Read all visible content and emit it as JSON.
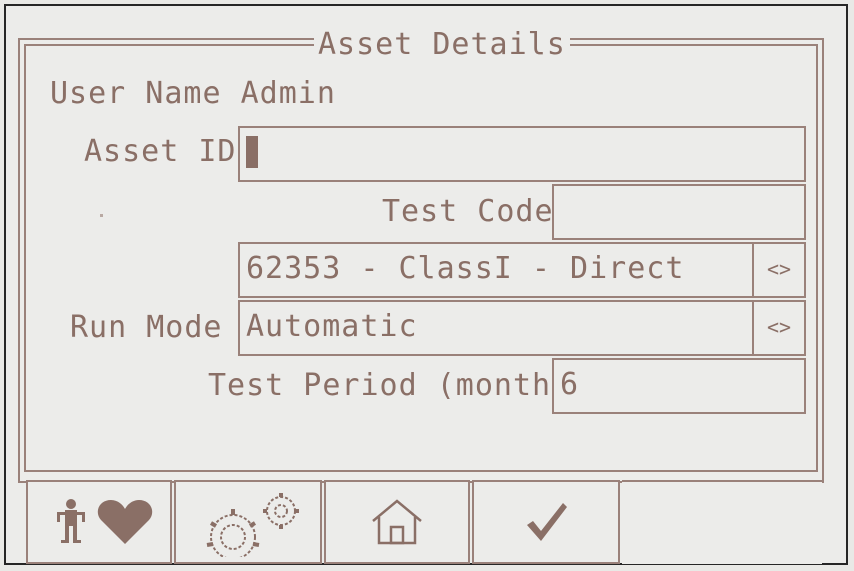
{
  "dialog": {
    "title": "Asset Details"
  },
  "form": {
    "user_name_label": "User Name",
    "user_name_value": "Admin",
    "asset_id_label": "Asset ID",
    "asset_id_value": "",
    "test_code_label": "Test Code",
    "test_code_value": "",
    "standard_value": "62353 - ClassI - Direct",
    "run_mode_label": "Run Mode",
    "run_mode_value": "Automatic",
    "test_period_label": "Test Period (months)",
    "test_period_value": "6",
    "spinner_glyph": "<>"
  },
  "toolbar": {
    "buttons": [
      {
        "icon": "patient-heart-icon"
      },
      {
        "icon": "settings-gears-icon"
      },
      {
        "icon": "home-icon"
      },
      {
        "icon": "checkmark-icon"
      }
    ]
  },
  "colors": {
    "text": "#8a6f66",
    "border": "#9a817a",
    "background": "#ececea",
    "bezel": "#262626"
  }
}
